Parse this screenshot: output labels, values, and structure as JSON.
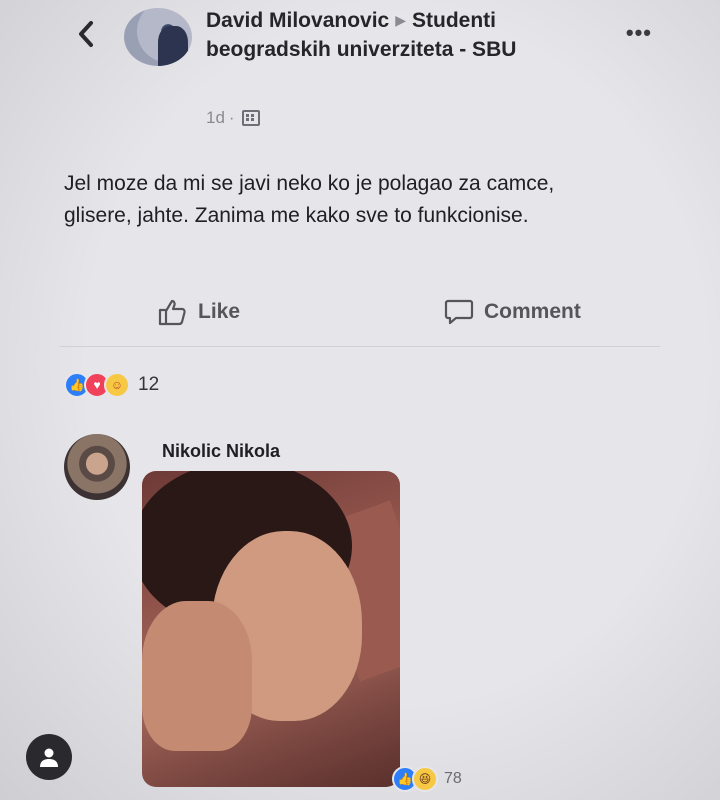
{
  "header": {
    "author": "David Milovanovic",
    "group": "Studenti beogradskih univerziteta - SBU",
    "time": "1d",
    "separator": "·"
  },
  "post": {
    "text": "Jel moze da mi se javi neko ko je polagao za camce, glisere, jahte. Zanima me kako sve to funkcionise."
  },
  "actions": {
    "like_label": "Like",
    "comment_label": "Comment"
  },
  "reactions": {
    "count": "12",
    "icons": [
      "like-icon",
      "love-icon",
      "care-icon"
    ]
  },
  "comment": {
    "author": "Nikolic Nikola",
    "reaction_count": "78",
    "reaction_icons": [
      "like-icon",
      "haha-icon"
    ]
  },
  "colors": {
    "background": "#e6e6ea",
    "like": "#2d7ff9",
    "love": "#f0405a"
  }
}
